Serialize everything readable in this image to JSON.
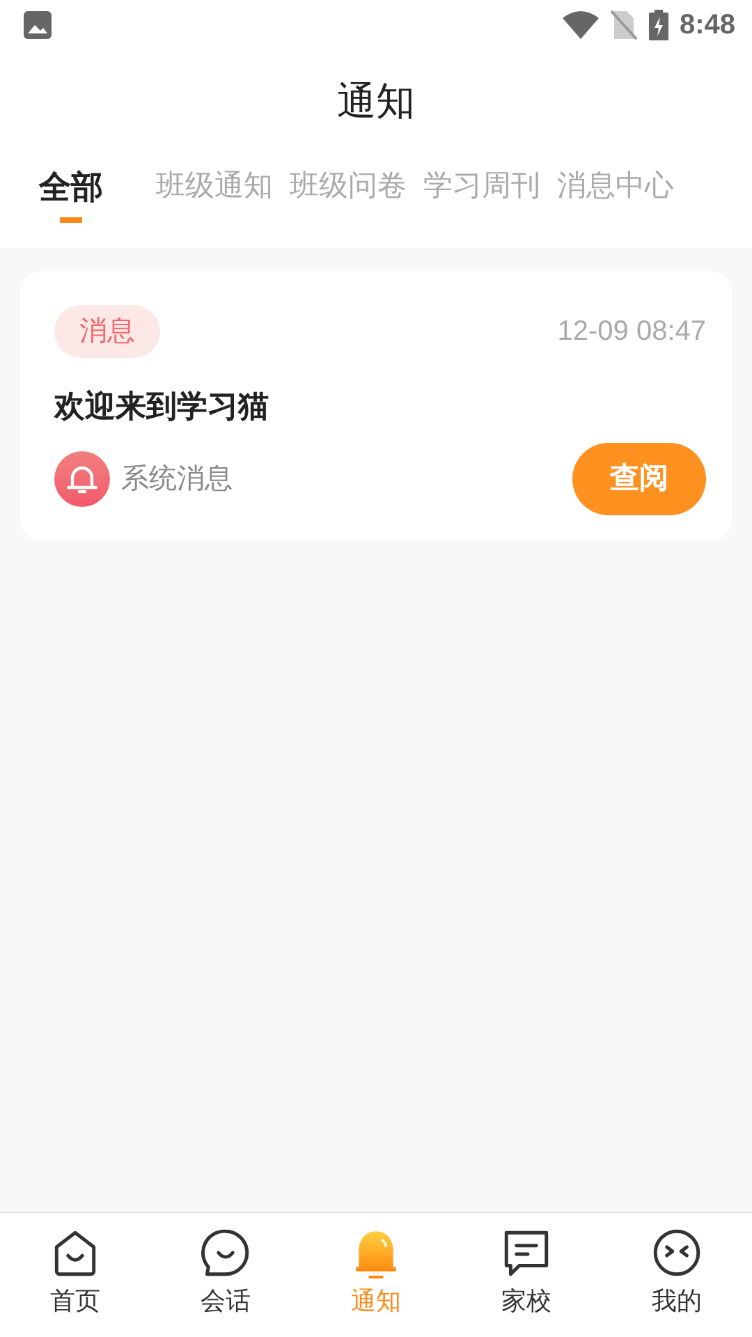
{
  "status_bar": {
    "time": "8:48"
  },
  "header": {
    "title": "通知"
  },
  "tabs": [
    {
      "label": "全部",
      "selected": true
    },
    {
      "label": "班级通知",
      "selected": false
    },
    {
      "label": "班级问卷",
      "selected": false
    },
    {
      "label": "学习周刊",
      "selected": false
    },
    {
      "label": "消息中心",
      "selected": false
    }
  ],
  "notices": [
    {
      "tag": "消息",
      "time": "12-09 08:47",
      "title": "欢迎来到学习猫",
      "source": "系统消息",
      "action": "查阅"
    }
  ],
  "bottom_nav": [
    {
      "kind": "home",
      "label": "首页",
      "selected": false
    },
    {
      "kind": "chat",
      "label": "会话",
      "selected": false
    },
    {
      "kind": "bell",
      "label": "通知",
      "selected": true
    },
    {
      "kind": "message",
      "label": "家校",
      "selected": false
    },
    {
      "kind": "face",
      "label": "我的",
      "selected": false
    }
  ]
}
